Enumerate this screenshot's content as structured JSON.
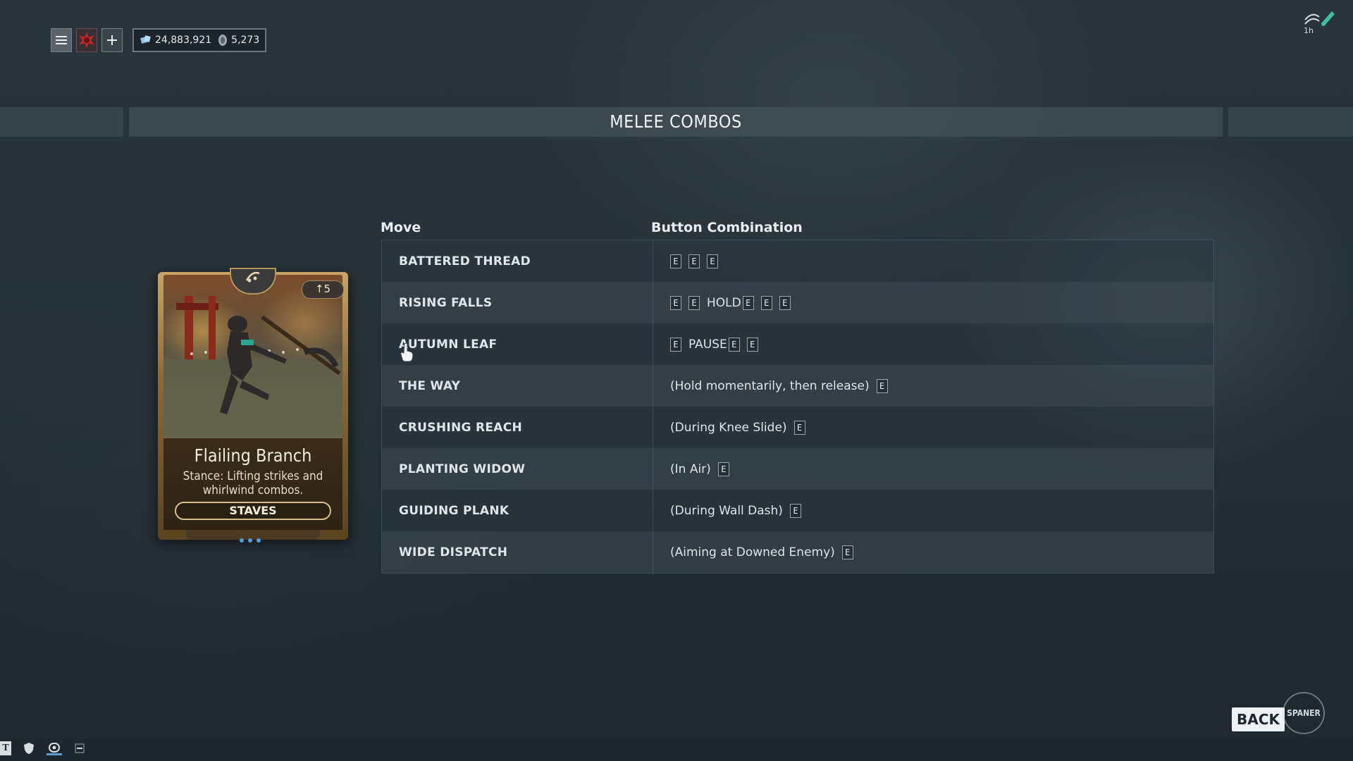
{
  "hud": {
    "icons": [
      "menu-icon",
      "clan-emblem-icon",
      "plus-icon"
    ],
    "credits": "24,883,921",
    "platinum": "5,273",
    "credits_icon": "credits-icon",
    "platinum_icon": "platinum-icon"
  },
  "daily": {
    "icon": "daily-tribute-icon",
    "label": "1h"
  },
  "page": {
    "title": "MELEE COMBOS"
  },
  "stance_card": {
    "name": "Flailing Branch",
    "description": "Stance: Lifting strikes and whirlwind combos.",
    "weapon_type": "STAVES",
    "drain": "↑5",
    "polarity_icon": "polarity-icon",
    "rank_dots": 3
  },
  "table": {
    "headers": {
      "move": "Move",
      "combo": "Button Combination"
    },
    "rows": [
      {
        "move": "BATTERED THREAD",
        "combo": [
          {
            "k": "E"
          },
          {
            "k": "E"
          },
          {
            "k": "E"
          }
        ]
      },
      {
        "move": "RISING FALLS",
        "combo": [
          {
            "k": "E"
          },
          {
            "k": "E"
          },
          {
            "t": "HOLD"
          },
          {
            "k": "E",
            "tight": true
          },
          {
            "k": "E"
          },
          {
            "k": "E"
          }
        ]
      },
      {
        "move": "AUTUMN LEAF",
        "combo": [
          {
            "k": "E"
          },
          {
            "t": "PAUSE"
          },
          {
            "k": "E",
            "tight": true
          },
          {
            "k": "E"
          }
        ]
      },
      {
        "move": "THE WAY",
        "combo": [
          {
            "t": "(Hold momentarily, then release)"
          },
          {
            "k": "E"
          }
        ]
      },
      {
        "move": "CRUSHING REACH",
        "combo": [
          {
            "t": "(During Knee Slide)"
          },
          {
            "k": "E"
          }
        ]
      },
      {
        "move": "PLANTING WIDOW",
        "combo": [
          {
            "t": "(In Air)"
          },
          {
            "k": "E"
          }
        ]
      },
      {
        "move": "GUIDING PLANK",
        "combo": [
          {
            "t": "(During Wall Dash)"
          },
          {
            "k": "E"
          }
        ]
      },
      {
        "move": "WIDE DISPATCH",
        "combo": [
          {
            "t": "(Aiming at Downed Enemy)"
          },
          {
            "k": "E"
          }
        ]
      }
    ]
  },
  "back": {
    "label": "BACK"
  },
  "watermark": {
    "text": "SPANER"
  },
  "tray": {
    "t_label": "T",
    "icons": [
      "t-icon",
      "shield-icon",
      "mod-icon",
      "minimize-icon"
    ]
  }
}
